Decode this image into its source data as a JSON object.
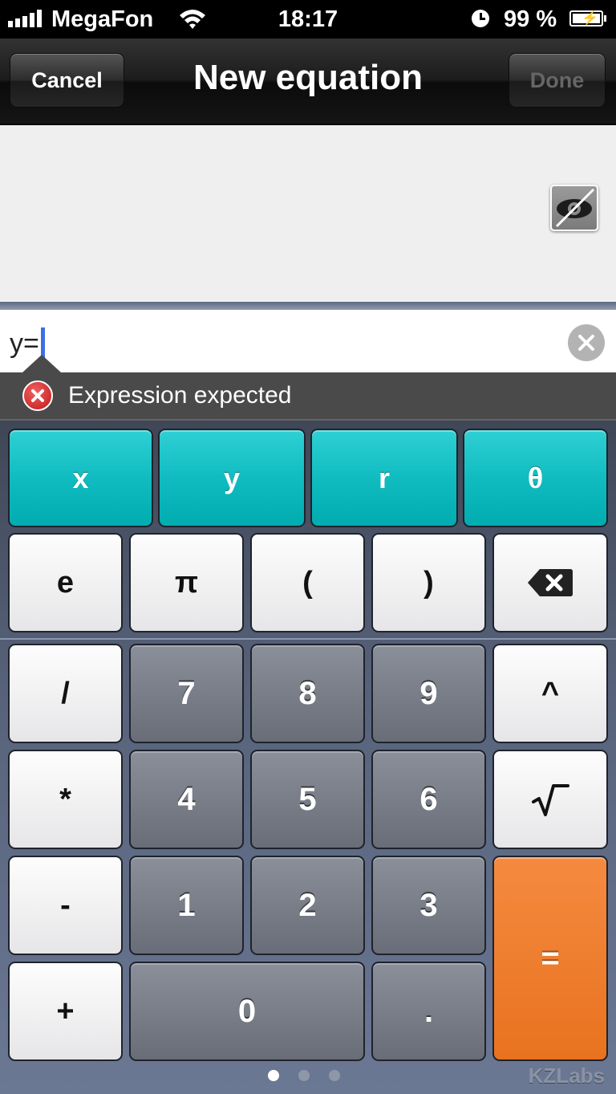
{
  "status_bar": {
    "carrier": "MegaFon",
    "time": "18:17",
    "battery_percent": "99 %",
    "icons": [
      "signal-icon",
      "wifi-icon",
      "clock-icon",
      "battery-charging-icon"
    ]
  },
  "nav": {
    "title": "New equation",
    "cancel_label": "Cancel",
    "done_label": "Done",
    "done_enabled": false
  },
  "preview": {
    "toggle_icon": "eye-hidden-icon"
  },
  "input": {
    "value": "y=",
    "clear_icon": "clear-icon"
  },
  "error": {
    "icon": "error-icon",
    "message": "Expression expected"
  },
  "keys": {
    "x": "x",
    "y": "y",
    "r": "r",
    "theta": "θ",
    "e": "e",
    "pi": "π",
    "lparen": "(",
    "rparen": ")",
    "backspace_icon": "backspace-icon",
    "divide": "/",
    "seven": "7",
    "eight": "8",
    "nine": "9",
    "power": "^",
    "multiply": "*",
    "four": "4",
    "five": "5",
    "six": "6",
    "sqrt_icon": "square-root-icon",
    "minus": "-",
    "one": "1",
    "two": "2",
    "three": "3",
    "equals": "=",
    "plus": "+",
    "zero": "0",
    "decimal": "."
  },
  "pager": {
    "pages": 3,
    "current": 1
  },
  "brand": "KZLabs",
  "colors": {
    "accent_teal": "#10bcc0",
    "equals_orange": "#e8721f",
    "caret_blue": "#3d6fe6",
    "error_red": "#c01818"
  }
}
